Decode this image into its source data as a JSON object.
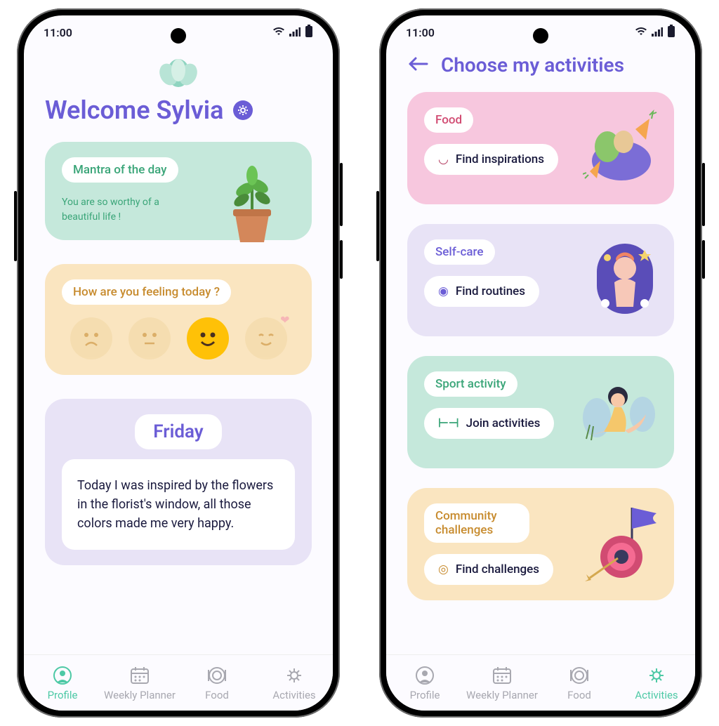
{
  "status_time": "11:00",
  "screen1": {
    "welcome": "Welcome Sylvia",
    "mantra_label": "Mantra of the day",
    "mantra_text": "You are so worthy of a beautiful life !",
    "feeling_label": "How are you feeling today ?",
    "day": "Friday",
    "journal": "Today I was inspired by the flowers in the florist's window, all those colors made me very happy."
  },
  "screen2": {
    "title": "Choose my activities",
    "food_label": "Food",
    "food_btn": "Find inspirations",
    "selfcare_label": "Self-care",
    "selfcare_btn": "Find routines",
    "sport_label": "Sport activity",
    "sport_btn": "Join activities",
    "community_label": "Community challenges",
    "community_btn": "Find challenges"
  },
  "nav": {
    "profile": "Profile",
    "planner": "Weekly Planner",
    "food": "Food",
    "activities": "Activities"
  }
}
